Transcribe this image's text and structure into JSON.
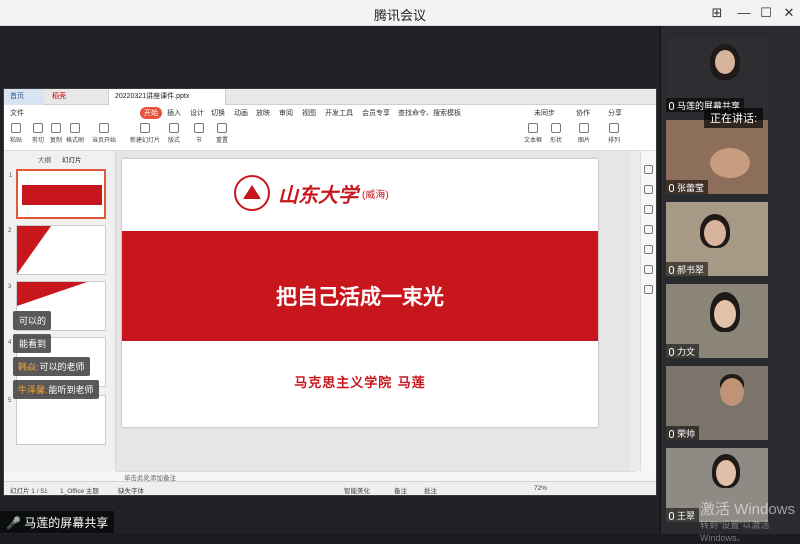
{
  "window": {
    "title": "腾讯会议",
    "min": "—",
    "max": "☐",
    "close": "✕",
    "pin": "⊞"
  },
  "ppt": {
    "tabs": {
      "home": "首页",
      "shell": "稻壳",
      "file": "20220321讲座课件.pptx"
    },
    "menu": [
      "文件",
      "开始",
      "插入",
      "设计",
      "切换",
      "动画",
      "放映",
      "审阅",
      "视图",
      "开发工具",
      "会员专享",
      "查找命令、搜索模板"
    ],
    "menu_right": [
      "未同步",
      "协作",
      "分享"
    ],
    "ribbon": [
      "粘贴",
      "剪切",
      "复制",
      "格式刷",
      "当页开始",
      "新建幻灯片",
      "版式",
      "节",
      "重置",
      "文本框",
      "形状",
      "图片",
      "排列"
    ],
    "left_tabs": [
      "大纲",
      "幻灯片"
    ],
    "thumb_nums": [
      "1",
      "2",
      "3",
      "4",
      "5"
    ],
    "slide": {
      "university": "山东大学",
      "campus": "(威海)",
      "title": "把自己活成一束光",
      "author": "马克思主义学院  马莲"
    },
    "notes_placeholder": "单击此处添加备注",
    "status": {
      "slide_count": "幻灯片 1 / 51",
      "theme": "1_Office 主题",
      "missing_font": "缺失字体",
      "beautify": "智能美化",
      "notes": "备注",
      "comment": "批注",
      "zoom": "72%"
    }
  },
  "chat": [
    {
      "who": "",
      "text": "可以的"
    },
    {
      "who": "",
      "text": "能看到"
    },
    {
      "who": "韩焱:",
      "text": "可以的老师"
    },
    {
      "who": "牛泽馨:",
      "text": "能听到老师"
    }
  ],
  "share_label": "马莲的屏幕共享",
  "sidebar": {
    "speaking": "正在讲话:",
    "participants": [
      "马莲的屏幕共享",
      "张蕾莹",
      "郝书翠",
      "力文",
      "荣帅",
      "王翠"
    ]
  },
  "watermark": {
    "line1": "激活 Windows",
    "line2": "转到\"设置\"以激活 Windows。"
  },
  "colors": {
    "accent": "#c7161c",
    "ribbon_active": "#e8533a"
  }
}
